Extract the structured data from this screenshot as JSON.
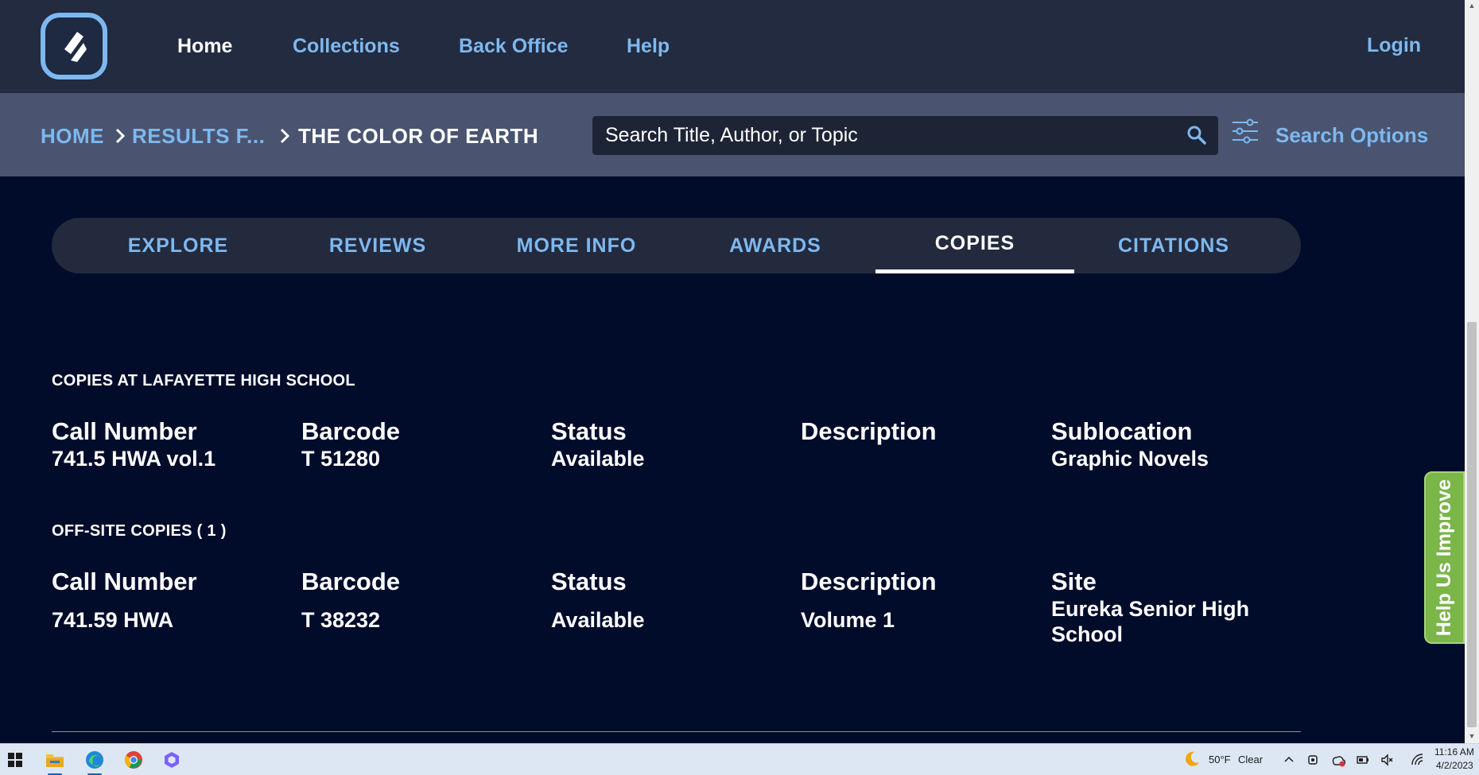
{
  "nav": {
    "items": [
      "Home",
      "Collections",
      "Back Office",
      "Help"
    ],
    "login": "Login"
  },
  "breadcrumb": {
    "home": "HOME",
    "results": "RESULTS F...",
    "current": "THE COLOR OF EARTH"
  },
  "search": {
    "placeholder": "Search Title, Author, or Topic",
    "options_label": "Search Options"
  },
  "tabs": [
    {
      "label": "EXPLORE",
      "active": false
    },
    {
      "label": "REVIEWS",
      "active": false
    },
    {
      "label": "MORE INFO",
      "active": false
    },
    {
      "label": "AWARDS",
      "active": false
    },
    {
      "label": "COPIES",
      "active": true
    },
    {
      "label": "CITATIONS",
      "active": false
    }
  ],
  "local_copies": {
    "title": "COPIES AT LAFAYETTE HIGH SCHOOL",
    "columns": [
      {
        "header": "Call Number",
        "value": "741.5 HWA vol.1"
      },
      {
        "header": "Barcode",
        "value": "T 51280"
      },
      {
        "header": "Status",
        "value": "Available"
      },
      {
        "header": "Description",
        "value": ""
      },
      {
        "header": "Sublocation",
        "value": "Graphic Novels"
      }
    ]
  },
  "offsite_copies": {
    "title": "OFF-SITE COPIES ( 1 )",
    "columns": [
      {
        "header": "Call Number",
        "value": "741.59 HWA"
      },
      {
        "header": "Barcode",
        "value": "T 38232"
      },
      {
        "header": "Status",
        "value": "Available"
      },
      {
        "header": "Description",
        "value": "Volume 1"
      },
      {
        "header": "Site",
        "value": "Eureka Senior High School"
      }
    ]
  },
  "feedback": {
    "label": "Help Us Improve"
  },
  "taskbar": {
    "weather": "50°F",
    "weather_condition": "Clear",
    "time": "11:16 AM",
    "date": "4/2/2023"
  },
  "colors": {
    "accent_link": "#7db8f0",
    "background": "#010c2b",
    "nav_bg": "#222b3f",
    "crumb_bg": "#4a5470",
    "feedback_green": "#7ab648"
  }
}
